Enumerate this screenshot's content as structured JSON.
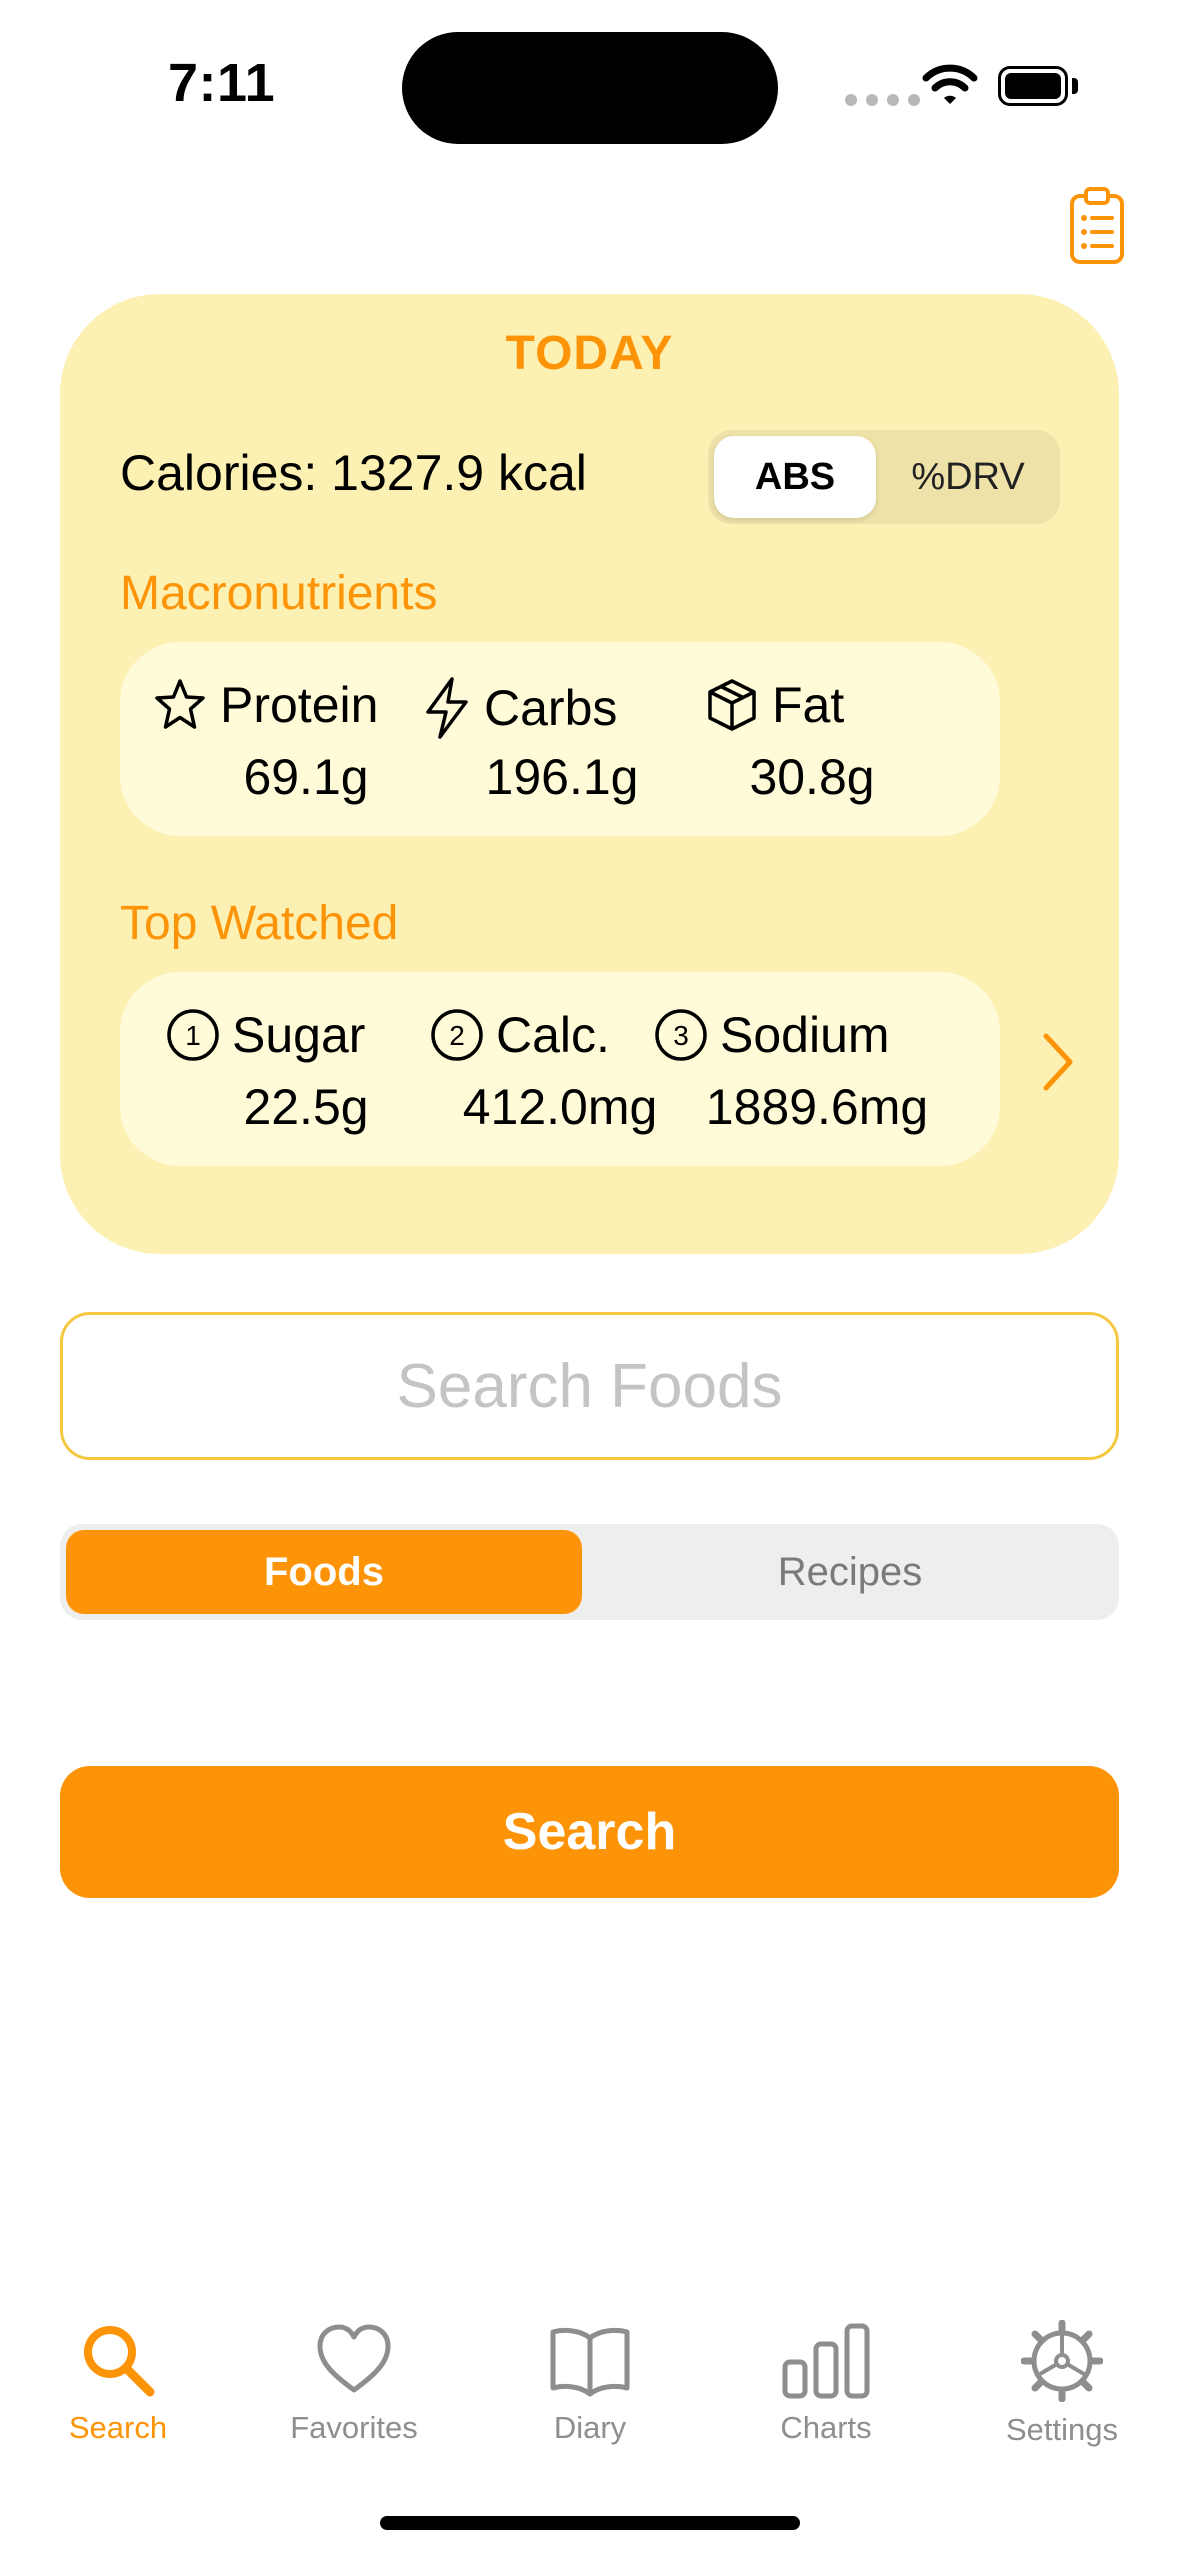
{
  "status_bar": {
    "time": "7:11"
  },
  "summary": {
    "title": "TODAY",
    "calories": "Calories: 1327.9 kcal",
    "mode_toggle": {
      "selected": "ABS",
      "other": "%DRV"
    },
    "macronutrients": {
      "label": "Macronutrients",
      "items": [
        {
          "name": "Protein",
          "value": "69.1g",
          "icon": "star-icon"
        },
        {
          "name": "Carbs",
          "value": "196.1g",
          "icon": "bolt-icon"
        },
        {
          "name": "Fat",
          "value": "30.8g",
          "icon": "cube-icon"
        }
      ]
    },
    "top_watched": {
      "label": "Top Watched",
      "items": [
        {
          "rank": "1",
          "name": "Sugar",
          "value": "22.5g"
        },
        {
          "rank": "2",
          "name": "Calc.",
          "value": "412.0mg"
        },
        {
          "rank": "3",
          "name": "Sodium",
          "value": "1889.6mg"
        }
      ]
    }
  },
  "search": {
    "placeholder": "Search Foods",
    "scope": {
      "selected": "Foods",
      "other": "Recipes"
    },
    "button": "Search"
  },
  "tab_bar": {
    "items": [
      {
        "label": "Search",
        "icon": "search-icon",
        "active": true
      },
      {
        "label": "Favorites",
        "icon": "heart-icon",
        "active": false
      },
      {
        "label": "Diary",
        "icon": "book-icon",
        "active": false
      },
      {
        "label": "Charts",
        "icon": "bar-chart-icon",
        "active": false
      },
      {
        "label": "Settings",
        "icon": "gear-icon",
        "active": false
      }
    ]
  },
  "colors": {
    "accent": "#fd9408",
    "card": "#fdf0b3",
    "inner": "#fffbd9",
    "inactive": "#8e8e8e"
  }
}
